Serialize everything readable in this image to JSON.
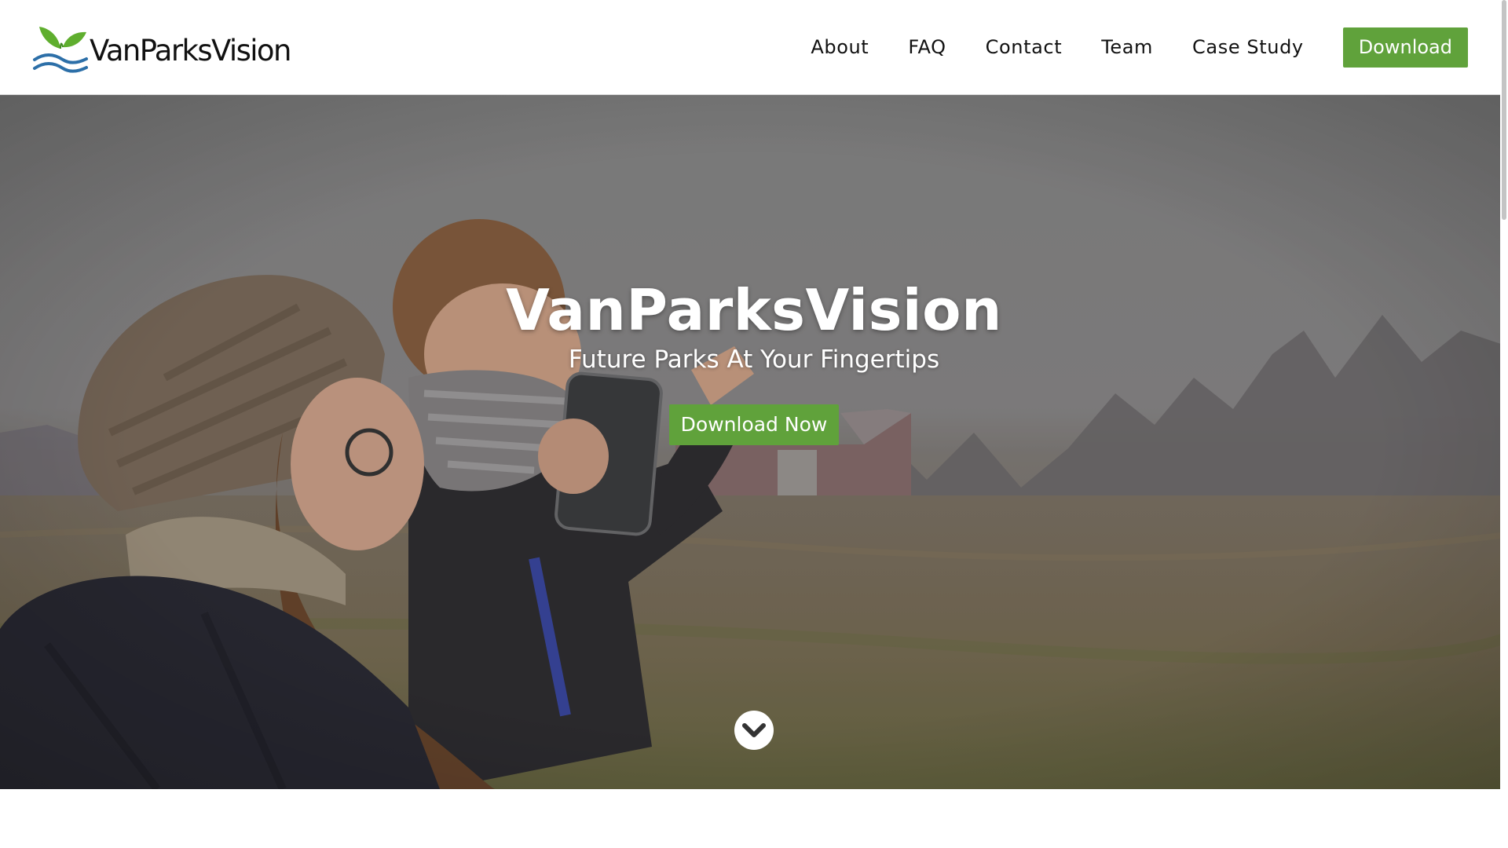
{
  "brand": {
    "name": "VanParksVision",
    "colors": {
      "accent": "#60a23b",
      "leaf": "#5fae2e",
      "wave": "#2c6fa8"
    }
  },
  "nav": {
    "items": [
      {
        "label": "About"
      },
      {
        "label": "FAQ"
      },
      {
        "label": "Contact"
      },
      {
        "label": "Team"
      },
      {
        "label": "Case Study"
      }
    ],
    "download_label": "Download"
  },
  "hero": {
    "title": "VanParksVision",
    "subtitle": "Future Parks At Your Fingertips",
    "cta_label": "Download Now",
    "scroll_icon": "chevron-down-circle-icon"
  }
}
